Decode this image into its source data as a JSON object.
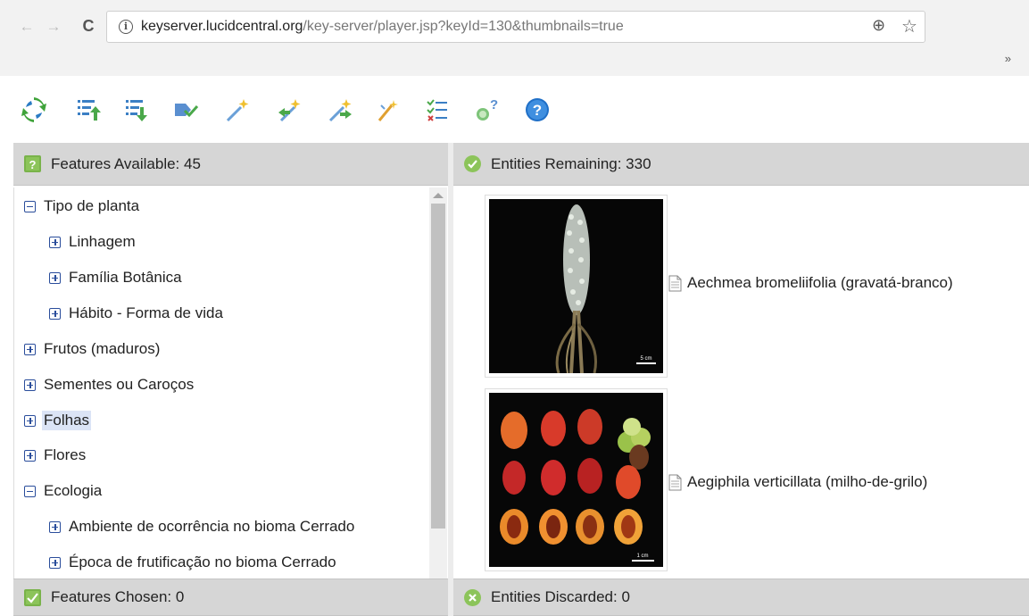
{
  "browser": {
    "url_host": "keyserver.lucidcentral.org",
    "url_rest": "/key-server/player.jsp?keyId=130&thumbnails=true",
    "icons": {
      "back": "back-arrow-icon",
      "forward": "forward-arrow-icon",
      "reload": "reload-icon",
      "info": "info-icon",
      "zoom": "zoom-icon",
      "bookmark": "star-icon",
      "overflow": "chevron-double-right-icon"
    },
    "back_glyph": "←",
    "forward_glyph": "→",
    "reload_glyph": "C",
    "info_glyph": "i",
    "zoom_glyph": "⊕",
    "star_glyph": "☆",
    "overflow_glyph": "»"
  },
  "toolbar": {
    "buttons": [
      {
        "icon": "restart-icon"
      },
      {
        "icon": "move-features-up-icon"
      },
      {
        "icon": "move-features-down-icon"
      },
      {
        "icon": "prune-icon"
      },
      {
        "icon": "best-feature-wand-icon"
      },
      {
        "icon": "wand-left-icon"
      },
      {
        "icon": "wand-right-icon"
      },
      {
        "icon": "magic-stick-icon"
      },
      {
        "icon": "list-icon"
      },
      {
        "icon": "differences-icon"
      },
      {
        "icon": "help-icon"
      }
    ]
  },
  "features_available": {
    "label": "Features Available: 45",
    "icon": "question-box-icon",
    "tree": [
      {
        "label": "Tipo de planta",
        "state": "expanded",
        "level": 0
      },
      {
        "label": "Linhagem",
        "state": "collapsed",
        "level": 1
      },
      {
        "label": "Família Botânica",
        "state": "collapsed",
        "level": 1
      },
      {
        "label": "Hábito - Forma de vida",
        "state": "collapsed",
        "level": 1
      },
      {
        "label": "Frutos (maduros)",
        "state": "collapsed",
        "level": 0
      },
      {
        "label": "Sementes ou Caroços",
        "state": "collapsed",
        "level": 0
      },
      {
        "label": "Folhas",
        "state": "collapsed",
        "level": 0,
        "selected": true
      },
      {
        "label": "Flores",
        "state": "collapsed",
        "level": 0
      },
      {
        "label": "Ecologia",
        "state": "expanded",
        "level": 0
      },
      {
        "label": "Ambiente de ocorrência no bioma Cerrado",
        "state": "collapsed",
        "level": 1
      },
      {
        "label": "Época de frutificação no bioma Cerrado",
        "state": "collapsed",
        "level": 1
      }
    ]
  },
  "entities_remaining": {
    "label": "Entities Remaining: 330",
    "icon": "check-circle-icon",
    "items": [
      {
        "name": "Aechmea bromeliifolia (gravatá-branco)",
        "scale": "5 cm"
      },
      {
        "name": "Aegiphila verticillata (milho-de-grilo)",
        "scale": "1 cm"
      }
    ]
  },
  "features_chosen": {
    "label": "Features Chosen: 0",
    "icon": "check-box-icon"
  },
  "entities_discarded": {
    "label": "Entities Discarded: 0",
    "icon": "x-circle-icon"
  },
  "colors": {
    "panel_header": "#d6d6d6",
    "tree_expander": "#2a4d9b",
    "selection": "#dbe4f6",
    "check_green": "#6cba3e",
    "help_blue": "#1f6fc7"
  }
}
